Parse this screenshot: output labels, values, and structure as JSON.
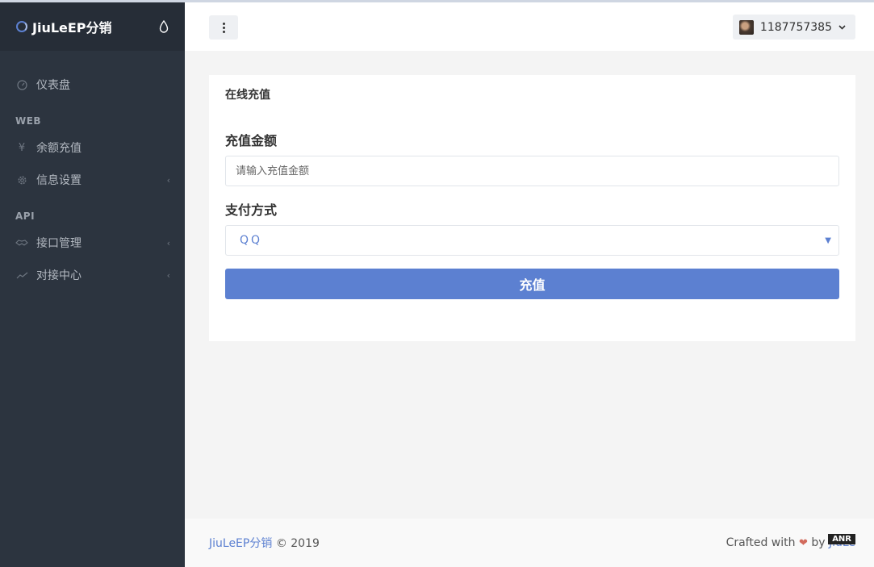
{
  "brand": {
    "name": "JiuLeEP分销"
  },
  "sidebar": {
    "items": [
      {
        "label": "仪表盘",
        "icon": "gauge-icon"
      },
      {
        "heading": "WEB"
      },
      {
        "label": "余额充值",
        "icon": "yen-icon"
      },
      {
        "label": "信息设置",
        "icon": "gear-icon",
        "has_submenu": true
      },
      {
        "heading": "API"
      },
      {
        "label": "接口管理",
        "icon": "handshake-icon",
        "has_submenu": true
      },
      {
        "label": "对接中心",
        "icon": "chart-line-icon",
        "has_submenu": true
      }
    ]
  },
  "header": {
    "user_id": "1187757385"
  },
  "card": {
    "title": "在线充值",
    "amount_label": "充值金额",
    "amount_placeholder": "请输入充值金额",
    "payment_label": "支付方式",
    "payment_selected": "QQ",
    "submit_label": "充值"
  },
  "footer": {
    "brand_link": "JiuLeEP分销",
    "copyright": "© 2019",
    "crafted_prefix": "Crafted with",
    "crafted_by": "by",
    "author_link": "JiuLe"
  },
  "watermark": "ANR",
  "colors": {
    "accent": "#5c80d1",
    "sidebar_bg": "#2c343f",
    "sidebar_head_bg": "#262d37"
  }
}
